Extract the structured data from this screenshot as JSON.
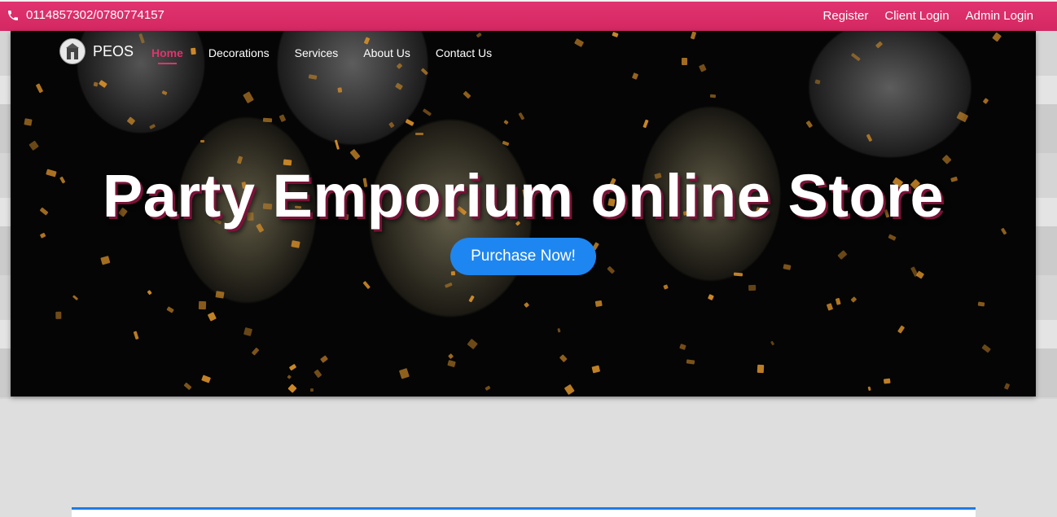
{
  "topbar": {
    "phone": "0114857302/0780774157",
    "links": [
      "Register",
      "Client Login",
      "Admin Login"
    ]
  },
  "navbar": {
    "brand": "PEOS",
    "items": [
      "Home",
      "Decorations",
      "Services",
      "About Us",
      "Contact Us"
    ],
    "active": "Home"
  },
  "hero": {
    "title": "Party Emporium online Store",
    "button": "Purchase Now!"
  },
  "colors": {
    "accent_pink": "#e0336f",
    "button_blue": "#1e86f0",
    "card_border": "#1e7ae6"
  }
}
